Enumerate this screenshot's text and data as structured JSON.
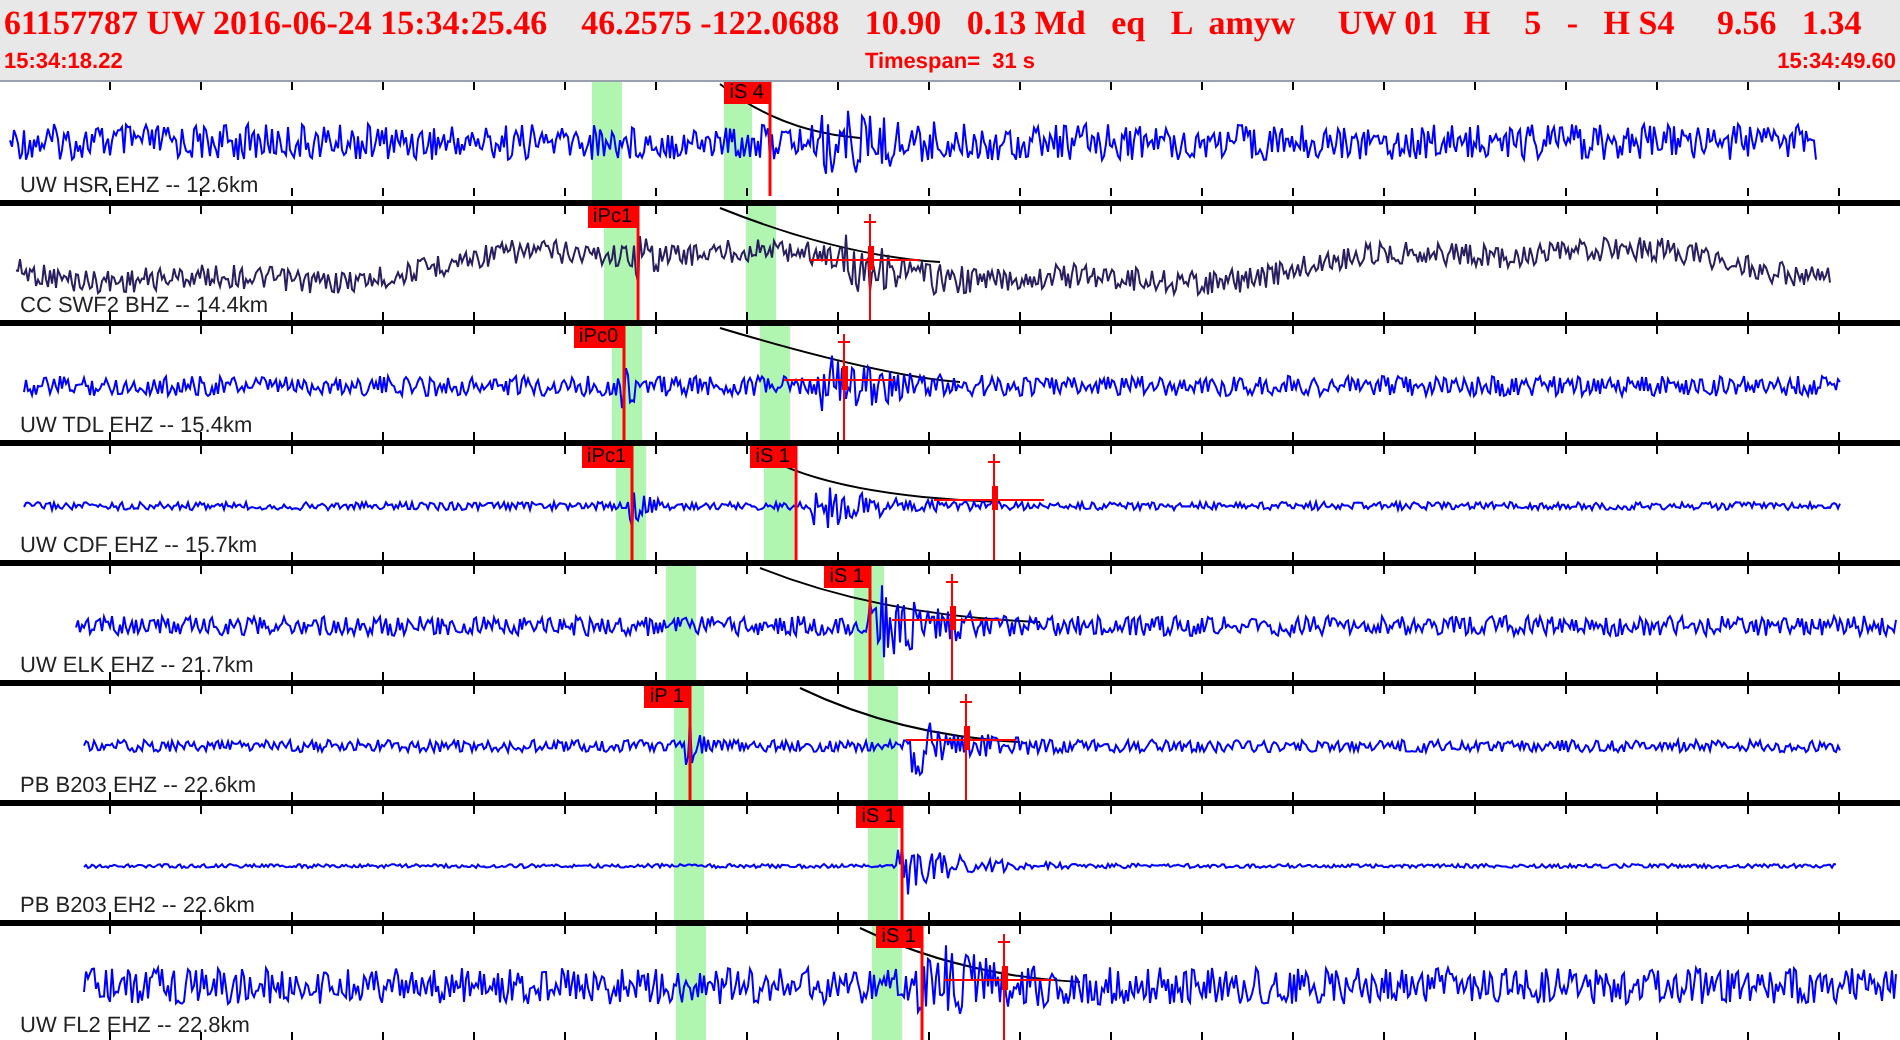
{
  "header": {
    "event_line": "61157787 UW 2016-06-24 15:34:25.46    46.2575 -122.0688   10.90   0.13 Md   eq   L  amyw     UW 01   H    5   -   H S4     9.56   1.34",
    "start_time": "15:34:18.22",
    "timespan": "Timespan=  31 s",
    "end_time": "15:34:49.60"
  },
  "traces": [
    {
      "label": "UW HSR EHZ -- 12.6km",
      "color": "#0000ff",
      "picks": [
        "iS 4"
      ]
    },
    {
      "label": "CC SWF2 BHZ -- 14.4km",
      "color": "#2a1f5e",
      "picks": [
        "iPc1"
      ]
    },
    {
      "label": "UW TDL EHZ -- 15.4km",
      "color": "#0000ff",
      "picks": [
        "iPc0"
      ]
    },
    {
      "label": "UW CDF EHZ -- 15.7km",
      "color": "#0000ff",
      "picks": [
        "iPc1",
        "iS 1"
      ]
    },
    {
      "label": "UW ELK EHZ -- 21.7km",
      "color": "#0000ff",
      "picks": [
        "iS 1"
      ]
    },
    {
      "label": "PB B203 EHZ -- 22.6km",
      "color": "#0000ff",
      "picks": [
        "iP 1"
      ]
    },
    {
      "label": "PB B203 EH2 -- 22.6km",
      "color": "#0000ff",
      "picks": [
        "iS 1"
      ]
    },
    {
      "label": "UW FL2 EHZ -- 22.8km",
      "color": "#0000ff",
      "picks": [
        "iS 1"
      ]
    }
  ]
}
